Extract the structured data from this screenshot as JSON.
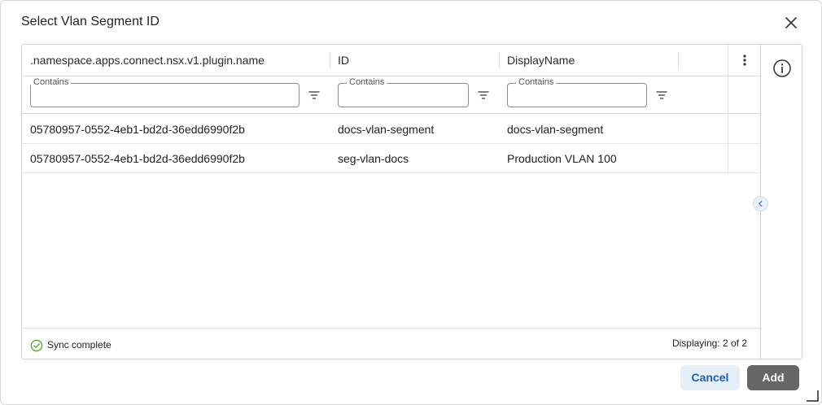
{
  "dialog": {
    "title": "Select Vlan Segment ID"
  },
  "table": {
    "columns": [
      ".namespace.apps.connect.nsx.v1.plugin.name",
      "ID",
      "DisplayName"
    ],
    "filters": [
      {
        "label": "Contains",
        "value": ""
      },
      {
        "label": "Contains",
        "value": ""
      },
      {
        "label": "Contains",
        "value": ""
      }
    ],
    "rows": [
      [
        "05780957-0552-4eb1-bd2d-36edd6990f2b",
        "docs-vlan-segment",
        "docs-vlan-segment"
      ],
      [
        "05780957-0552-4eb1-bd2d-36edd6990f2b",
        "seg-vlan-docs",
        "Production VLAN 100"
      ]
    ]
  },
  "footer": {
    "sync_status": "Sync complete",
    "count": "Displaying: 2 of 2"
  },
  "buttons": {
    "cancel": "Cancel",
    "add": "Add"
  },
  "icons": {
    "close": "close-icon",
    "info": "info-icon",
    "kebab": "more-vertical-icon",
    "filter": "filter-icon",
    "sync": "check-circle-icon",
    "collapse": "chevron-left-icon",
    "resize": "resize-handle-icon"
  },
  "colors": {
    "accent": "#1a5fb4",
    "success": "#5aa832",
    "primary_button": "#666666",
    "secondary_button_bg": "#e6eef8"
  }
}
